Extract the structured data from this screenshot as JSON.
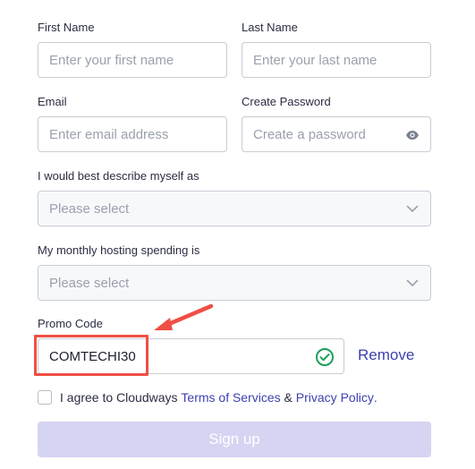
{
  "form": {
    "first_name": {
      "label": "First Name",
      "placeholder": "Enter your first name"
    },
    "last_name": {
      "label": "Last Name",
      "placeholder": "Enter your last name"
    },
    "email": {
      "label": "Email",
      "placeholder": "Enter email address"
    },
    "password": {
      "label": "Create Password",
      "placeholder": "Create a password"
    },
    "describe": {
      "label": "I would best describe myself as",
      "selected": "Please select"
    },
    "spending": {
      "label": "My monthly hosting spending is",
      "selected": "Please select"
    },
    "promo": {
      "label": "Promo Code",
      "value": "COMTECHI30",
      "remove_label": "Remove"
    },
    "agree": {
      "prefix": "I agree to Cloudways ",
      "terms": "Terms of Services",
      "amp": " & ",
      "privacy": "Privacy Policy",
      "suffix": "."
    },
    "submit_label": "Sign up"
  },
  "icons": {
    "password_toggle": "eye-icon",
    "select_chevron": "chevron-down-icon",
    "promo_valid": "check-circle-icon",
    "annotation_arrow": "arrow-icon"
  },
  "colors": {
    "accent": "#3d3fb0",
    "annotation": "#ef4f45",
    "valid": "#1e9e5a",
    "button_disabled": "#d5d4f3"
  }
}
